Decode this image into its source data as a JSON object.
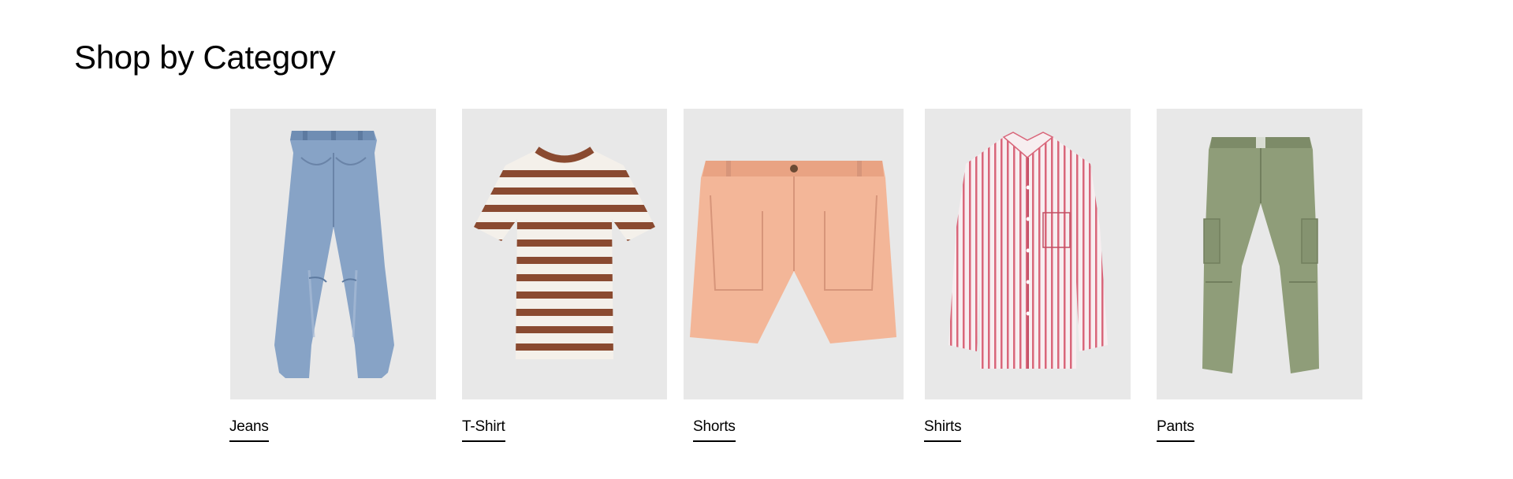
{
  "section": {
    "title": "Shop by Category"
  },
  "categories": [
    {
      "label": "Jeans",
      "image": "jeans-product-photo"
    },
    {
      "label": "T-Shirt",
      "image": "striped-tshirt-product-photo"
    },
    {
      "label": "Shorts",
      "image": "peach-shorts-product-photo"
    },
    {
      "label": "Shirts",
      "image": "striped-shirt-product-photo"
    },
    {
      "label": "Pants",
      "image": "olive-cargo-pants-product-photo"
    }
  ],
  "colors": {
    "image_background": "#e8e8e8",
    "denim": "#7f9cc0",
    "tee_stripe": "#8a4a30",
    "shorts_peach": "#f2b597",
    "shirt_stripe": "#d9667a",
    "pants_olive": "#8e9c78"
  }
}
